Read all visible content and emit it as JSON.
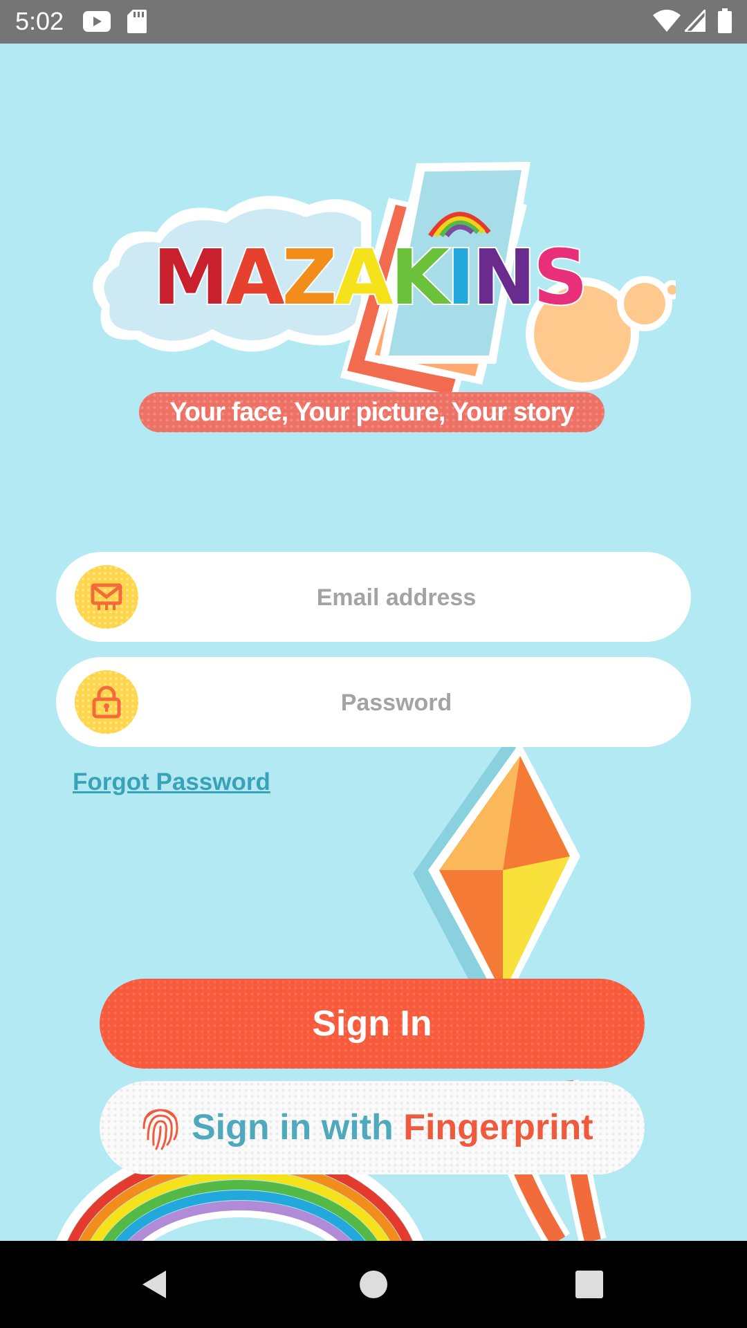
{
  "status_bar": {
    "time": "5:02",
    "left_icons": [
      "youtube-icon",
      "sd-card-icon"
    ],
    "right_icons": [
      "wifi-icon",
      "signal-icon",
      "battery-icon"
    ]
  },
  "logo": {
    "text": "MAZAKINS",
    "letters": [
      {
        "char": "M",
        "color": "#c8202d"
      },
      {
        "char": "A",
        "color": "#e5412e"
      },
      {
        "char": "Z",
        "color": "#f28c1a"
      },
      {
        "char": "A",
        "color": "#f5e21a"
      },
      {
        "char": "K",
        "color": "#6cc13a"
      },
      {
        "char": "I",
        "color": "#23a8dd"
      },
      {
        "char": "N",
        "color": "#6a2b8e"
      },
      {
        "char": "S",
        "color": "#e8307a"
      }
    ]
  },
  "tagline": "Your face, Your picture, Your story",
  "form": {
    "email": {
      "placeholder": "Email address",
      "value": "",
      "icon": "mail-icon"
    },
    "password": {
      "placeholder": "Password",
      "value": "",
      "icon": "lock-icon"
    },
    "forgot_password": "Forgot Password"
  },
  "buttons": {
    "sign_in": "Sign In",
    "fingerprint_part1": "Sign in with",
    "fingerprint_part2": "Fingerprint",
    "fingerprint_icon": "fingerprint-icon"
  },
  "colors": {
    "background": "#b3e9f3",
    "primary": "#f85a3c",
    "accent_blue": "#4fa9bc",
    "icon_circle": "#ffd64a"
  },
  "nav_bar": [
    "back-icon",
    "home-icon",
    "recents-icon"
  ]
}
